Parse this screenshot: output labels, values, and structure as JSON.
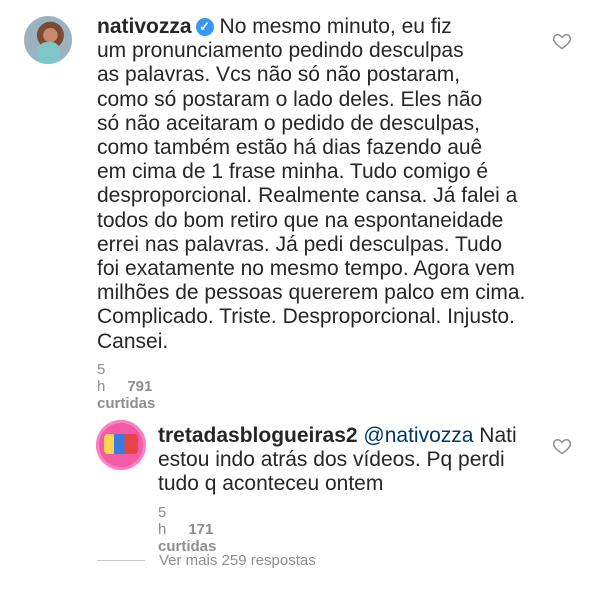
{
  "comment1": {
    "username": "nativozza",
    "verified": true,
    "text": "No mesmo minuto, eu fiz\num pronunciamento pedindo desculpas\nas palavras. Vcs não só não postaram,\ncomo só postaram o lado deles. Eles não\nsó não aceitaram o pedido de desculpas,\ncomo também estão há dias fazendo auê\nem cima de 1 frase minha. Tudo comigo é\ndesproporcional. Realmente cansa. Já falei a\ntodos do bom retiro que na espontaneidade\nerrei nas palavras. Já pedi desculpas. Tudo\nfoi exatamente no mesmo tempo. Agora vem\nmilhões de pessoas quererem palco em cima.\nComplicado. Triste. Desproporcional. Injusto.\nCansei.",
    "time": "5 h",
    "likes": "791 curtidas",
    "heart_icon": "heart-outline-icon"
  },
  "comment2": {
    "username": "tretadasblogueiras2",
    "mention": "@nativozza",
    "text": " Nati\nestou indo atrás dos vídeos. Pq perdi\ntudo q aconteceu ontem",
    "time": "5 h",
    "likes": "171 curtidas",
    "heart_icon": "heart-outline-icon"
  },
  "view_more": {
    "label": "Ver mais 259 respostas"
  },
  "colors": {
    "text": "#262626",
    "meta": "#8e8e8e",
    "mention": "#00376b",
    "verified": "#3897f0"
  }
}
